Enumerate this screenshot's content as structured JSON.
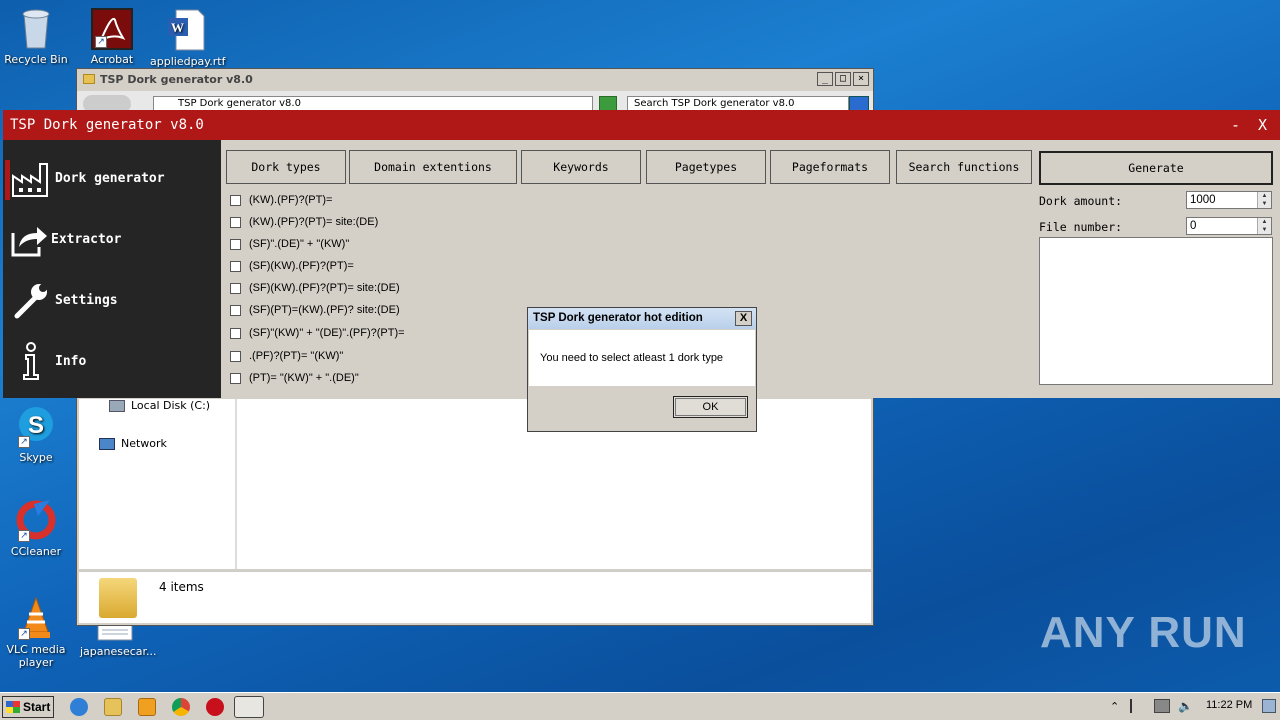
{
  "desktop": {
    "icons": [
      {
        "label": "Recycle Bin"
      },
      {
        "label": "Acrobat"
      },
      {
        "label": "appliedpay.rtf"
      },
      {
        "label": "Skype"
      },
      {
        "label": "CCleaner"
      },
      {
        "label": "VLC media player"
      },
      {
        "label": "japanesecar..."
      }
    ],
    "watermark": "ANY RUN"
  },
  "explorer": {
    "title": "TSP Dork generator v8.0",
    "address": "TSP Dork generator v8.0",
    "search_placeholder": "Search TSP Dork generator v8.0",
    "side_items": [
      "Local Disk (C:)",
      "Network"
    ],
    "status": "4 items"
  },
  "app": {
    "title": "TSP Dork generator v8.0",
    "minimize": "-",
    "close": "X",
    "sidebar": [
      {
        "label": "Dork generator",
        "icon": "factory-icon"
      },
      {
        "label": "Extractor",
        "icon": "share-arrow-icon"
      },
      {
        "label": "Settings",
        "icon": "wrench-icon"
      },
      {
        "label": "Info",
        "icon": "info-icon"
      }
    ],
    "tabs": [
      "Dork types",
      "Domain extentions",
      "Keywords",
      "Pagetypes",
      "Pageformats",
      "Search functions"
    ],
    "generate_label": "Generate",
    "dork_types": [
      "(KW).(PF)?(PT)=",
      "(KW).(PF)?(PT)= site:(DE)",
      "(SF)\".(DE)\" + \"(KW)\"",
      "(SF)(KW).(PF)?(PT)=",
      "(SF)(KW).(PF)?(PT)= site:(DE)",
      "(SF)(PT)=(KW).(PF)? site:(DE)",
      "(SF)\"(KW)\" + \"(DE)\".(PF)?(PT)=",
      ".(PF)?(PT)= \"(KW)\"",
      "(PT)= \"(KW)\" + \".(DE)\""
    ],
    "dork_amount_label": "Dork amount:",
    "dork_amount_value": "1000",
    "file_number_label": "File number:",
    "file_number_value": "0"
  },
  "dialog": {
    "title": "TSP Dork generator hot edition",
    "close": "X",
    "message": "You need to select atleast 1 dork type",
    "ok_label": "OK"
  },
  "taskbar": {
    "start_label": "Start",
    "clock": "11:22 PM"
  }
}
